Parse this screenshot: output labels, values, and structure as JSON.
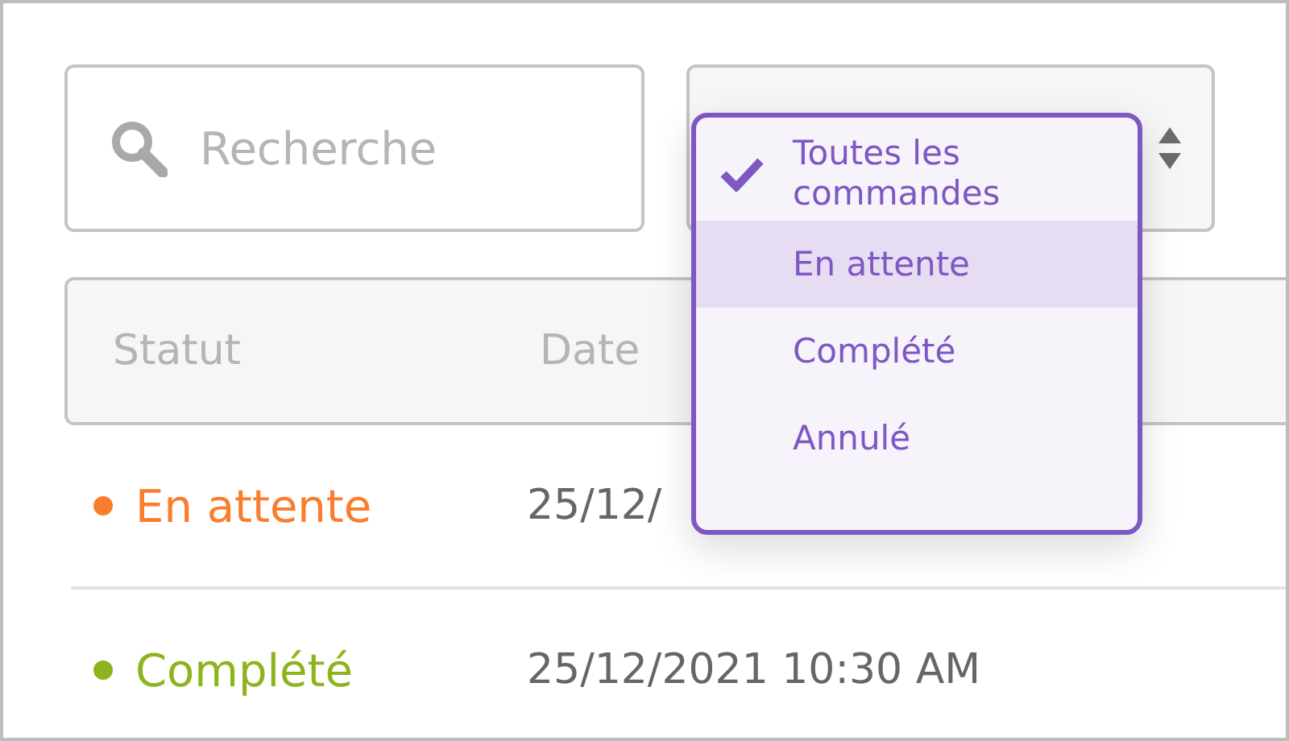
{
  "search": {
    "placeholder": "Recherche"
  },
  "filter": {
    "options": [
      {
        "label": "Toutes les commandes",
        "selected": true,
        "highlighted": false
      },
      {
        "label": "En attente",
        "selected": false,
        "highlighted": true
      },
      {
        "label": "Complété",
        "selected": false,
        "highlighted": false
      },
      {
        "label": "Annulé",
        "selected": false,
        "highlighted": false
      }
    ]
  },
  "table": {
    "columns": [
      "Statut",
      "Date"
    ],
    "rows": [
      {
        "status": "En attente",
        "color": "#fa7d2e",
        "date": "25/12/"
      },
      {
        "status": "Complété",
        "color": "#8db41f",
        "date": "25/12/2021 10:30 AM"
      }
    ]
  }
}
